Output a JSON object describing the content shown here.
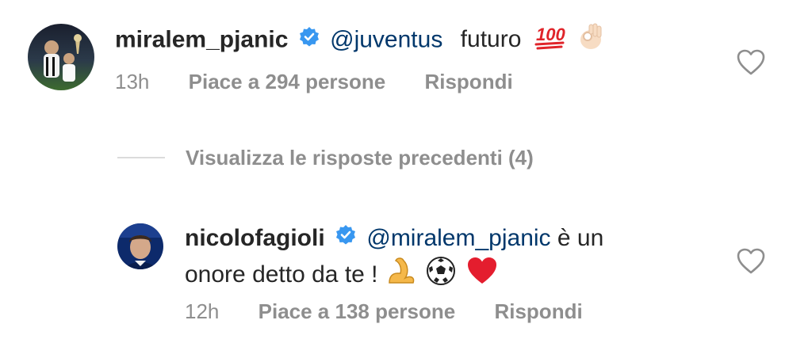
{
  "comment_1": {
    "username": "miralem_pjanic",
    "mention": "@juventus",
    "text": "futuro",
    "emojis": [
      "hundred-points-emoji",
      "ok-hand-emoji"
    ],
    "time": "13h",
    "likes": "Piace a 294 persone",
    "reply_label": "Rispondi"
  },
  "view_replies": {
    "label": "Visualizza le risposte precedenti (4)"
  },
  "comment_2": {
    "username": "nicolofagioli",
    "mention": "@miralem_pjanic",
    "text_line1": "è un",
    "text_line2": "onore detto da te !",
    "emojis": [
      "flexed-biceps-emoji",
      "soccer-ball-emoji",
      "red-heart-emoji"
    ],
    "time": "12h",
    "likes": "Piace a 138 persone",
    "reply_label": "Rispondi"
  },
  "colors": {
    "text": "#262626",
    "meta": "#8e8e8e",
    "mention": "#00376b",
    "verified": "#3897f0",
    "divider": "#dbdbdb"
  },
  "icons": [
    "verified-badge-icon",
    "heart-outline-icon"
  ]
}
